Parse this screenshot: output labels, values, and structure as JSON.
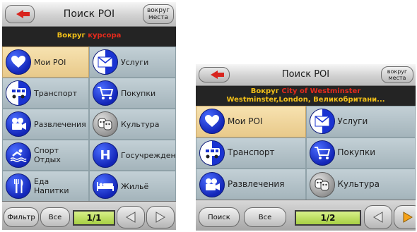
{
  "left": {
    "title": "Поиск POI",
    "around_line1": "вокруг",
    "around_line2": "места",
    "location_prefix": "Вокруг",
    "location_value": "курсора",
    "categories": [
      {
        "label": "Мои POI",
        "icon": "heart-icon"
      },
      {
        "label": "Услуги",
        "icon": "envelope-icon"
      },
      {
        "label": "Транспорт",
        "icon": "bus-icon"
      },
      {
        "label": "Покупки",
        "icon": "shopping-cart-icon"
      },
      {
        "label": "Развлечения",
        "icon": "film-camera-icon"
      },
      {
        "label": "Культура",
        "icon": "theater-masks-icon"
      },
      {
        "label": "Спорт\nОтдых",
        "icon": "swimmer-icon"
      },
      {
        "label": "Госучреждения",
        "icon": "h-letter-icon"
      },
      {
        "label": "Еда\nНапитки",
        "icon": "fork-knife-icon"
      },
      {
        "label": "Жильё",
        "icon": "bed-icon"
      }
    ],
    "footer": {
      "filter_label": "Фильтр",
      "all_label": "Все",
      "page": "1/1"
    }
  },
  "right": {
    "title": "Поиск POI",
    "around_line1": "вокруг",
    "around_line2": "места",
    "location_prefix": "Вокруг",
    "location_value": "City of Westminster",
    "location_line2": "Westminster,London, Великобритани...",
    "categories": [
      {
        "label": "Мои POI",
        "icon": "heart-icon"
      },
      {
        "label": "Услуги",
        "icon": "envelope-icon"
      },
      {
        "label": "Транспорт",
        "icon": "bus-icon"
      },
      {
        "label": "Покупки",
        "icon": "shopping-cart-icon"
      },
      {
        "label": "Развлечения",
        "icon": "film-camera-icon"
      },
      {
        "label": "Культура",
        "icon": "theater-masks-icon"
      }
    ],
    "footer": {
      "search_label": "Поиск",
      "all_label": "Все",
      "page": "1/2"
    }
  },
  "colors": {
    "accent_yellow": "#f4c118",
    "accent_red": "#e22a1c",
    "selected_cell": "#f2d89e",
    "icon_blue": "#1a33d1",
    "page_green": "#a7cf43"
  }
}
